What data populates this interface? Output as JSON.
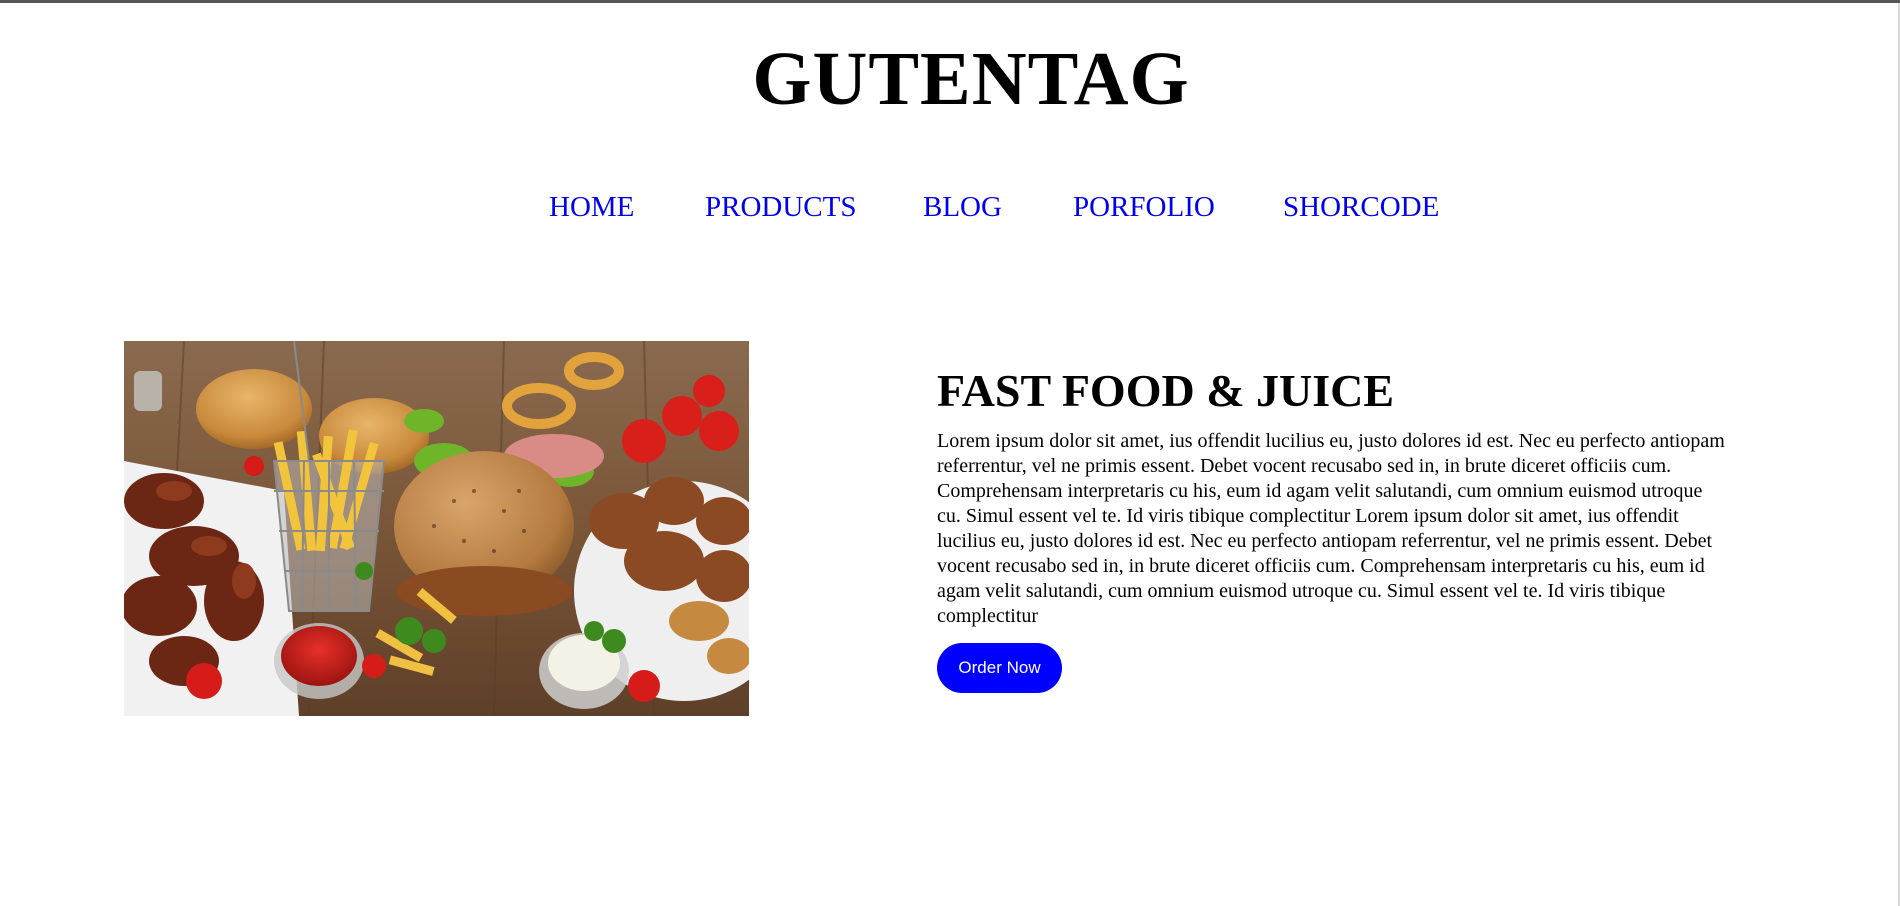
{
  "site": {
    "title": "GUTENTAG"
  },
  "nav": {
    "items": [
      {
        "label": "HOME"
      },
      {
        "label": "PRODUCTS"
      },
      {
        "label": "BLOG"
      },
      {
        "label": "PORFOLIO"
      },
      {
        "label": "SHORCODE"
      }
    ]
  },
  "hero": {
    "image_subject": "fast-food-spread",
    "heading": "FAST FOOD & JUICE",
    "body": "Lorem ipsum dolor sit amet, ius offendit lucilius eu, justo dolores id est. Nec eu perfecto antiopam referrentur, vel ne primis essent. Debet vocent recusabo sed in, in brute diceret officiis cum. Comprehensam interpretaris cu his, eum id agam velit salutandi, cum omnium euismod utroque cu. Simul essent vel te. Id viris tibique complectitur Lorem ipsum dolor sit amet, ius offendit lucilius eu, justo dolores id est. Nec eu perfecto antiopam referrentur, vel ne primis essent. Debet vocent recusabo sed in, in brute diceret officiis cum. Comprehensam interpretaris cu his, eum id agam velit salutandi, cum omnium euismod utroque cu. Simul essent vel te. Id viris tibique complectitur",
    "button_label": "Order Now"
  },
  "colors": {
    "link": "#0000ee",
    "button": "#0000ff",
    "button_text": "#ffffff"
  }
}
